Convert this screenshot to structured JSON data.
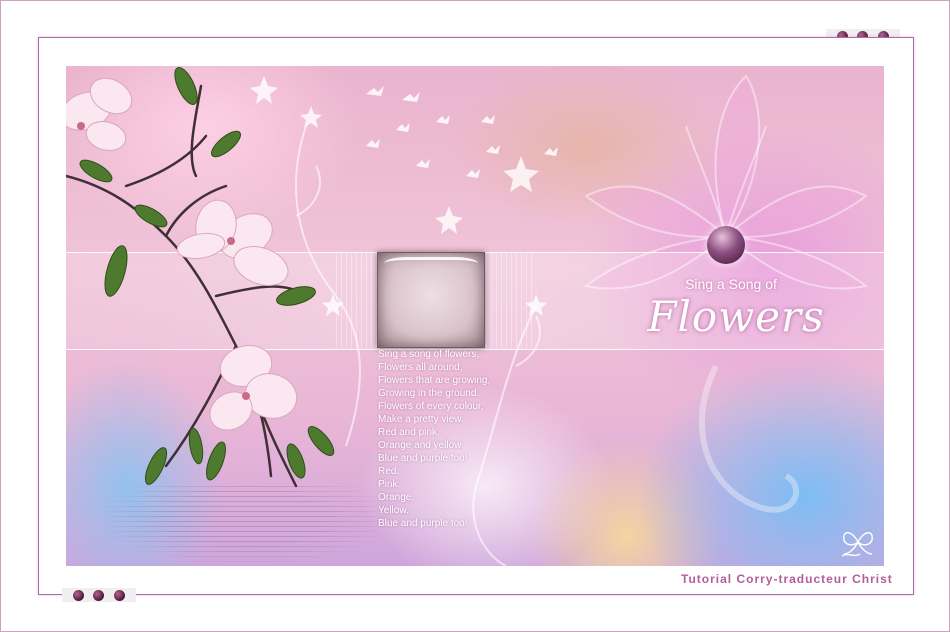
{
  "title": {
    "line1": "Sing a Song of",
    "line2": "Flowers"
  },
  "poem": [
    "Sing a song of flowers,",
    "Flowers all around,",
    "Flowers that are growing,",
    "Growing in the ground.",
    "Flowers of every colour,",
    "Make a pretty view.",
    "Red and pink,",
    "Orange and yellow,",
    "Blue and purple too!",
    "Red.",
    "Pink.",
    "Orange.",
    "Yellow.",
    "Blue and purple too!"
  ],
  "credit": "Tutorial Corry-traducteur Christ",
  "colors": {
    "frame_border": "#b26aa6",
    "credit_text": "#b45d9c",
    "dot": "#4a1735",
    "bead": "#8b4f80"
  },
  "icons": {
    "decor_dots": "dot-icon",
    "bead": "bead-icon",
    "signature": "butterfly-signature-icon"
  }
}
